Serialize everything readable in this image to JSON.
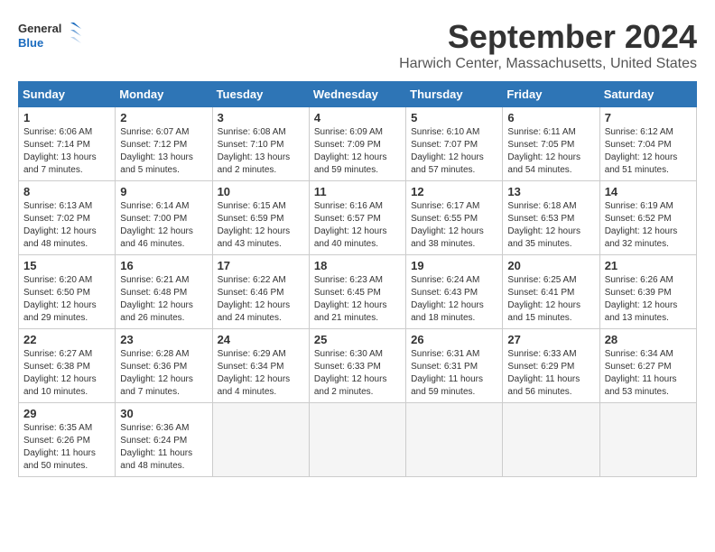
{
  "logo": {
    "line1": "General",
    "line2": "Blue"
  },
  "title": "September 2024",
  "location": "Harwich Center, Massachusetts, United States",
  "weekdays": [
    "Sunday",
    "Monday",
    "Tuesday",
    "Wednesday",
    "Thursday",
    "Friday",
    "Saturday"
  ],
  "weeks": [
    [
      {
        "day": "1",
        "info": "Sunrise: 6:06 AM\nSunset: 7:14 PM\nDaylight: 13 hours\nand 7 minutes."
      },
      {
        "day": "2",
        "info": "Sunrise: 6:07 AM\nSunset: 7:12 PM\nDaylight: 13 hours\nand 5 minutes."
      },
      {
        "day": "3",
        "info": "Sunrise: 6:08 AM\nSunset: 7:10 PM\nDaylight: 13 hours\nand 2 minutes."
      },
      {
        "day": "4",
        "info": "Sunrise: 6:09 AM\nSunset: 7:09 PM\nDaylight: 12 hours\nand 59 minutes."
      },
      {
        "day": "5",
        "info": "Sunrise: 6:10 AM\nSunset: 7:07 PM\nDaylight: 12 hours\nand 57 minutes."
      },
      {
        "day": "6",
        "info": "Sunrise: 6:11 AM\nSunset: 7:05 PM\nDaylight: 12 hours\nand 54 minutes."
      },
      {
        "day": "7",
        "info": "Sunrise: 6:12 AM\nSunset: 7:04 PM\nDaylight: 12 hours\nand 51 minutes."
      }
    ],
    [
      {
        "day": "8",
        "info": "Sunrise: 6:13 AM\nSunset: 7:02 PM\nDaylight: 12 hours\nand 48 minutes."
      },
      {
        "day": "9",
        "info": "Sunrise: 6:14 AM\nSunset: 7:00 PM\nDaylight: 12 hours\nand 46 minutes."
      },
      {
        "day": "10",
        "info": "Sunrise: 6:15 AM\nSunset: 6:59 PM\nDaylight: 12 hours\nand 43 minutes."
      },
      {
        "day": "11",
        "info": "Sunrise: 6:16 AM\nSunset: 6:57 PM\nDaylight: 12 hours\nand 40 minutes."
      },
      {
        "day": "12",
        "info": "Sunrise: 6:17 AM\nSunset: 6:55 PM\nDaylight: 12 hours\nand 38 minutes."
      },
      {
        "day": "13",
        "info": "Sunrise: 6:18 AM\nSunset: 6:53 PM\nDaylight: 12 hours\nand 35 minutes."
      },
      {
        "day": "14",
        "info": "Sunrise: 6:19 AM\nSunset: 6:52 PM\nDaylight: 12 hours\nand 32 minutes."
      }
    ],
    [
      {
        "day": "15",
        "info": "Sunrise: 6:20 AM\nSunset: 6:50 PM\nDaylight: 12 hours\nand 29 minutes."
      },
      {
        "day": "16",
        "info": "Sunrise: 6:21 AM\nSunset: 6:48 PM\nDaylight: 12 hours\nand 26 minutes."
      },
      {
        "day": "17",
        "info": "Sunrise: 6:22 AM\nSunset: 6:46 PM\nDaylight: 12 hours\nand 24 minutes."
      },
      {
        "day": "18",
        "info": "Sunrise: 6:23 AM\nSunset: 6:45 PM\nDaylight: 12 hours\nand 21 minutes."
      },
      {
        "day": "19",
        "info": "Sunrise: 6:24 AM\nSunset: 6:43 PM\nDaylight: 12 hours\nand 18 minutes."
      },
      {
        "day": "20",
        "info": "Sunrise: 6:25 AM\nSunset: 6:41 PM\nDaylight: 12 hours\nand 15 minutes."
      },
      {
        "day": "21",
        "info": "Sunrise: 6:26 AM\nSunset: 6:39 PM\nDaylight: 12 hours\nand 13 minutes."
      }
    ],
    [
      {
        "day": "22",
        "info": "Sunrise: 6:27 AM\nSunset: 6:38 PM\nDaylight: 12 hours\nand 10 minutes."
      },
      {
        "day": "23",
        "info": "Sunrise: 6:28 AM\nSunset: 6:36 PM\nDaylight: 12 hours\nand 7 minutes."
      },
      {
        "day": "24",
        "info": "Sunrise: 6:29 AM\nSunset: 6:34 PM\nDaylight: 12 hours\nand 4 minutes."
      },
      {
        "day": "25",
        "info": "Sunrise: 6:30 AM\nSunset: 6:33 PM\nDaylight: 12 hours\nand 2 minutes."
      },
      {
        "day": "26",
        "info": "Sunrise: 6:31 AM\nSunset: 6:31 PM\nDaylight: 11 hours\nand 59 minutes."
      },
      {
        "day": "27",
        "info": "Sunrise: 6:33 AM\nSunset: 6:29 PM\nDaylight: 11 hours\nand 56 minutes."
      },
      {
        "day": "28",
        "info": "Sunrise: 6:34 AM\nSunset: 6:27 PM\nDaylight: 11 hours\nand 53 minutes."
      }
    ],
    [
      {
        "day": "29",
        "info": "Sunrise: 6:35 AM\nSunset: 6:26 PM\nDaylight: 11 hours\nand 50 minutes."
      },
      {
        "day": "30",
        "info": "Sunrise: 6:36 AM\nSunset: 6:24 PM\nDaylight: 11 hours\nand 48 minutes."
      },
      null,
      null,
      null,
      null,
      null
    ]
  ]
}
